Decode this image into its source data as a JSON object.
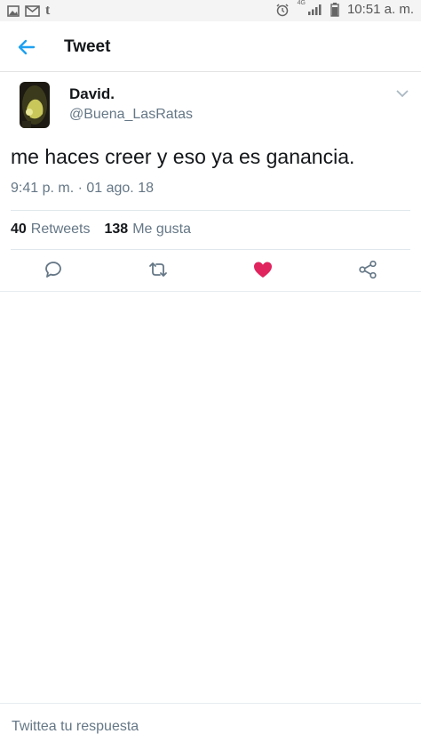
{
  "status_bar": {
    "carrier_icon": "t",
    "network": "4G",
    "time": "10:51 a. m."
  },
  "app_bar": {
    "title": "Tweet",
    "back_icon": "arrow-left-icon"
  },
  "tweet": {
    "author_name": "David.",
    "author_handle": "@Buena_LasRatas",
    "text": "me haces creer y eso ya es ganancia.",
    "timestamp": "9:41 p. m. · 01 ago. 18",
    "retweets_count": "40",
    "retweets_label": "Retweets",
    "likes_count": "138",
    "likes_label": "Me gusta"
  },
  "actions": [
    "reply-icon",
    "retweet-icon",
    "heart-icon",
    "share-icon"
  ],
  "colors": {
    "accent": "#1da1f2",
    "like": "#e0245e",
    "secondary_text": "#657786",
    "divider": "#e1e8ed"
  },
  "reply": {
    "placeholder": "Twittea tu respuesta"
  }
}
